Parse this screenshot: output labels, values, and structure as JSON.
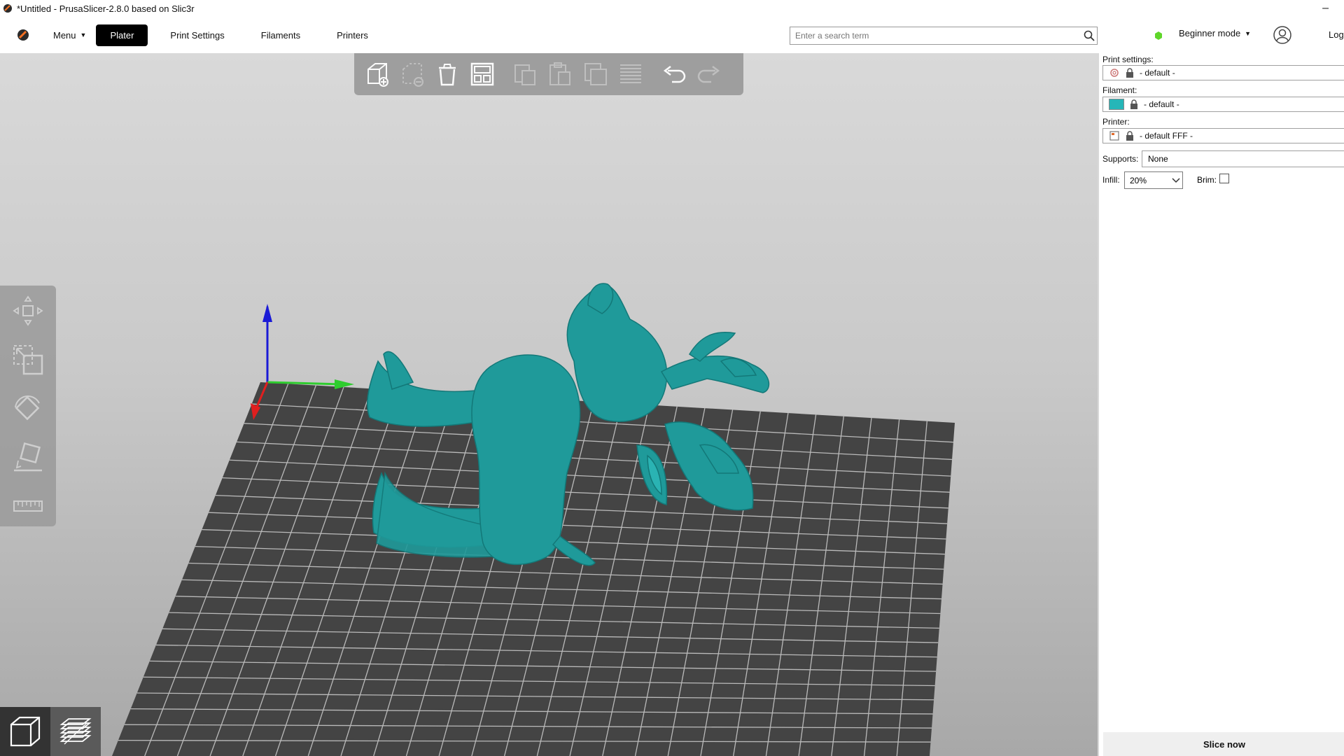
{
  "window": {
    "title": "*Untitled - PrusaSlicer-2.8.0 based on Slic3r",
    "minimize_glyph": "–"
  },
  "menubar": {
    "menu_label": "Menu",
    "tabs": [
      {
        "label": "Plater",
        "active": true
      },
      {
        "label": "Print Settings",
        "active": false
      },
      {
        "label": "Filaments",
        "active": false
      },
      {
        "label": "Printers",
        "active": false
      }
    ],
    "search_placeholder": "Enter a search term",
    "mode_label": "Beginner mode",
    "mode_color": "#5fd62a",
    "login_label": "Log"
  },
  "toolbar": {
    "icons": [
      "add-icon",
      "delete-icon",
      "delete-all-icon",
      "arrange-icon",
      "copy-icon",
      "paste-icon",
      "instances-icon",
      "split-icon",
      "undo-icon",
      "redo-icon"
    ]
  },
  "gizmos": [
    "move-icon",
    "scale-icon",
    "rotate-icon",
    "place-on-face-icon",
    "measure-icon"
  ],
  "sidebar": {
    "print_settings_label": "Print settings:",
    "print_settings_value": "- default -",
    "filament_label": "Filament:",
    "filament_value": "- default -",
    "filament_color": "#26b6b8",
    "printer_label": "Printer:",
    "printer_value": "- default FFF -",
    "supports_label": "Supports:",
    "supports_value": "None",
    "infill_label": "Infill:",
    "infill_value": "20%",
    "brim_label": "Brim:",
    "brim_checked": false,
    "slice_label": "Slice now"
  },
  "colors": {
    "model": "#1f9a9a",
    "bed": "#444444",
    "grid": "#cfcfcf",
    "accent": "#000000"
  }
}
